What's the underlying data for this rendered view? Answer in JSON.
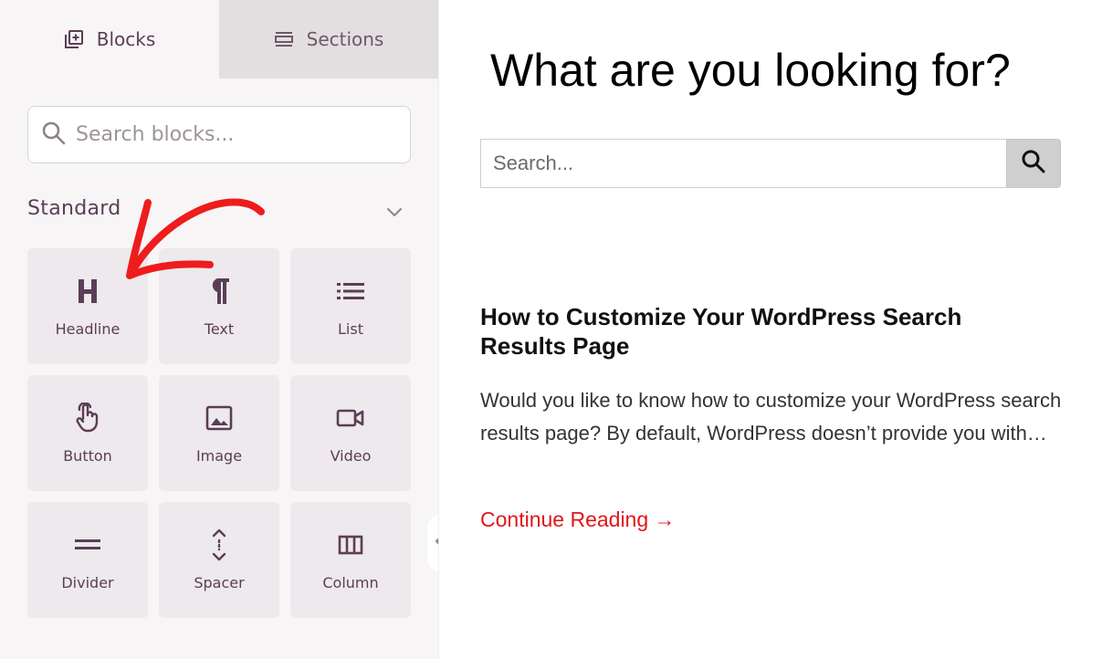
{
  "sidebar": {
    "tabs": {
      "blocks_label": "Blocks",
      "sections_label": "Sections"
    },
    "search": {
      "placeholder": "Search blocks..."
    },
    "section": {
      "title": "Standard"
    },
    "blocks": [
      {
        "label": "Headline",
        "icon": "headline-icon"
      },
      {
        "label": "Text",
        "icon": "paragraph-icon"
      },
      {
        "label": "List",
        "icon": "list-icon"
      },
      {
        "label": "Button",
        "icon": "pointer-hand-icon"
      },
      {
        "label": "Image",
        "icon": "image-icon"
      },
      {
        "label": "Video",
        "icon": "video-icon"
      },
      {
        "label": "Divider",
        "icon": "divider-icon"
      },
      {
        "label": "Spacer",
        "icon": "spacer-icon"
      },
      {
        "label": "Column",
        "icon": "columns-icon"
      }
    ]
  },
  "preview": {
    "heading": "What are you looking for?",
    "search": {
      "placeholder": "Search..."
    },
    "post": {
      "title": "How to Customize Your WordPress Search Results Page",
      "excerpt": "Would you like to know how to customize your WordPress search results page? By default, WordPress doesn’t provide you with…",
      "read_more": "Continue Reading →"
    }
  },
  "colors": {
    "accent": "#5b3e55",
    "panel_bg": "#f7f5f6",
    "block_bg": "#ede9ec",
    "link_red": "#e0161b",
    "annotation_red": "#ee1c1c"
  }
}
